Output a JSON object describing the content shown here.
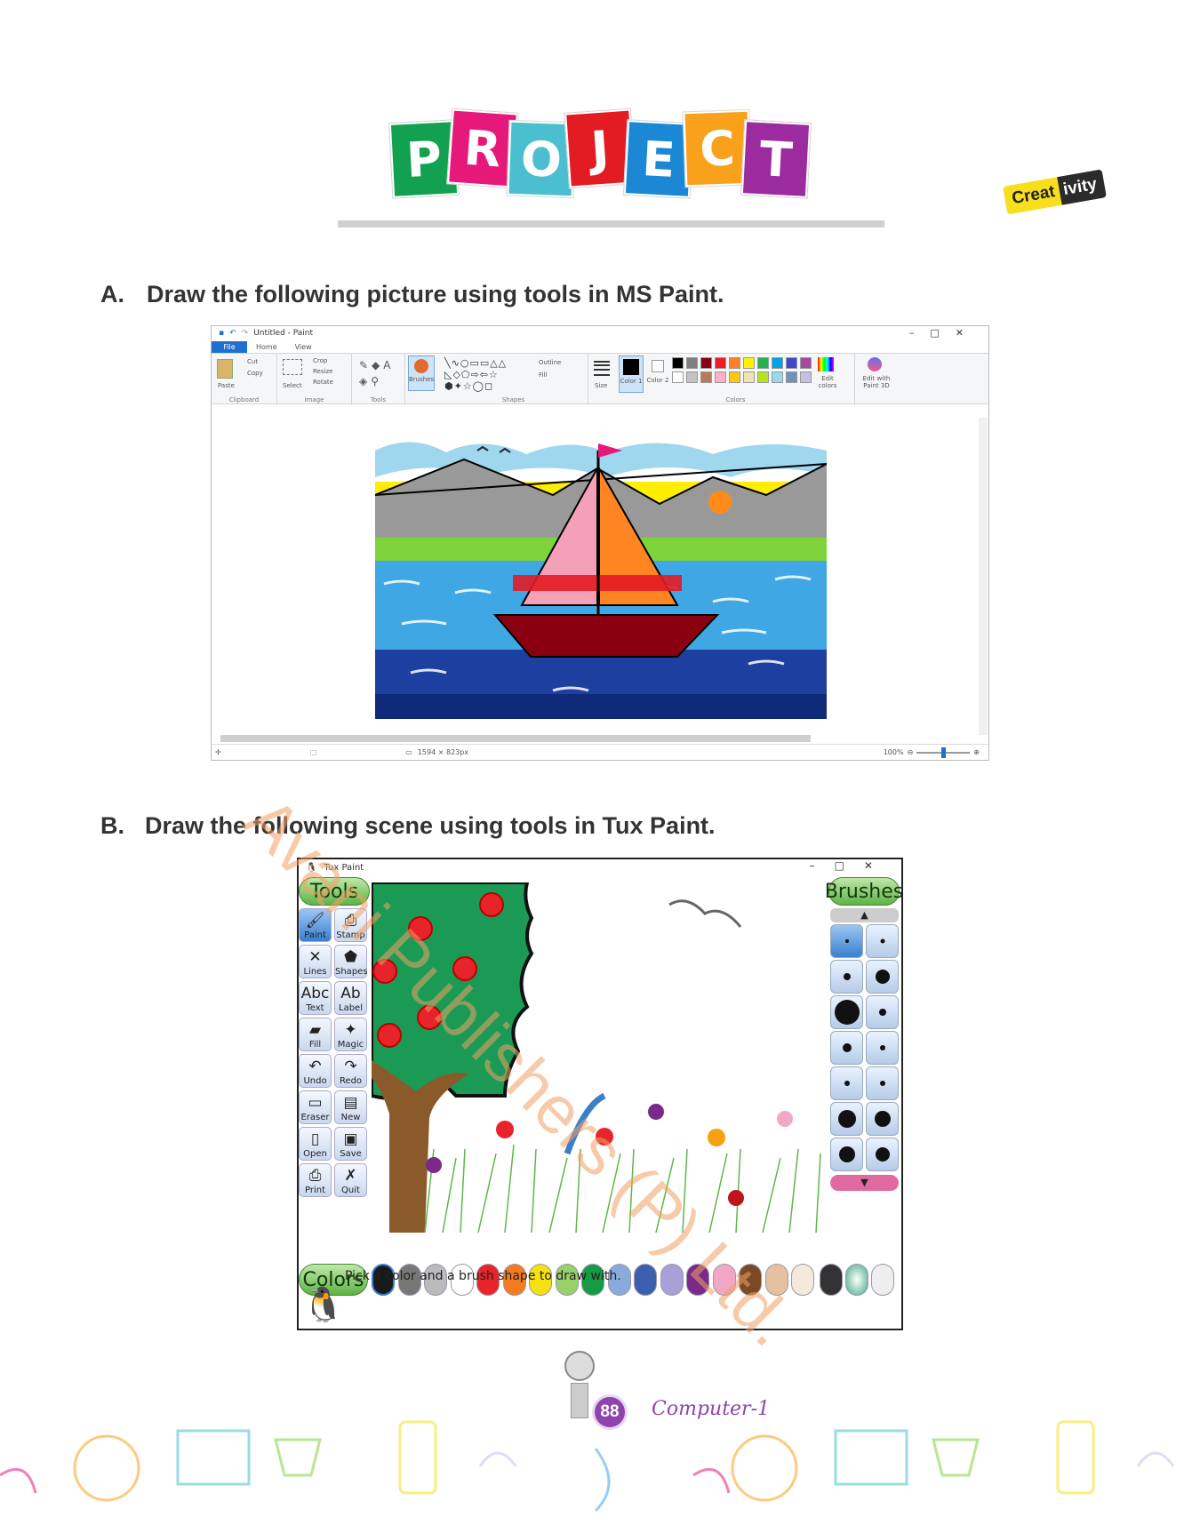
{
  "header": {
    "title_letters": [
      {
        "ch": "P",
        "color": "#12a150"
      },
      {
        "ch": "R",
        "color": "#e6197b"
      },
      {
        "ch": "O",
        "color": "#4bbfcf"
      },
      {
        "ch": "J",
        "color": "#e31b23"
      },
      {
        "ch": "E",
        "color": "#1a88d4"
      },
      {
        "ch": "C",
        "color": "#f9a11b"
      },
      {
        "ch": "T",
        "color": "#9b2b9e"
      }
    ],
    "badge_part1": "Creat",
    "badge_part2": "ivity"
  },
  "section_a": {
    "label": "A.",
    "text": "Draw the following picture using tools in MS Paint."
  },
  "paint": {
    "title": "Untitled - Paint",
    "tabs": [
      "File",
      "Home",
      "View"
    ],
    "clipboard": {
      "paste": "Paste",
      "cut": "Cut",
      "copy": "Copy",
      "group": "Clipboard"
    },
    "image": {
      "select": "Select",
      "crop": "Crop",
      "resize": "Resize",
      "rotate": "Rotate",
      "group": "Image"
    },
    "tools_group": "Tools",
    "brushes": "Brushes",
    "shapes": {
      "outline": "Outline",
      "fill": "Fill",
      "group": "Shapes"
    },
    "size": "Size",
    "color1": "Color 1",
    "color2": "Color 2",
    "colors_group": "Colors",
    "edit_colors": "Edit colors",
    "edit_3d": "Edit with Paint 3D",
    "dimensions": "1594 × 823px",
    "zoom": "100%",
    "palette": [
      "#000000",
      "#7f7f7f",
      "#880015",
      "#ed1c24",
      "#ff7f27",
      "#fff200",
      "#22b14c",
      "#00a2e8",
      "#3f48cc",
      "#a349a4",
      "#ffffff",
      "#c3c3c3",
      "#b97a57",
      "#ffaec9",
      "#ffc90e",
      "#efe4b0",
      "#b5e61d",
      "#99d9ea",
      "#7092be",
      "#c8bfe7"
    ]
  },
  "section_b": {
    "label": "B.",
    "text": "Draw the following scene using tools in Tux Paint."
  },
  "tux": {
    "title": "Tux Paint",
    "tools_header": "Tools",
    "brushes_header": "Brushes",
    "colors_header": "Colors",
    "tools": [
      {
        "label": "Paint",
        "icon": "🖌"
      },
      {
        "label": "Stamp",
        "icon": "⎙"
      },
      {
        "label": "Lines",
        "icon": "✕"
      },
      {
        "label": "Shapes",
        "icon": "⬟"
      },
      {
        "label": "Text",
        "icon": "Abc"
      },
      {
        "label": "Label",
        "icon": "Ab"
      },
      {
        "label": "Fill",
        "icon": "▰"
      },
      {
        "label": "Magic",
        "icon": "✦"
      },
      {
        "label": "Undo",
        "icon": "↶"
      },
      {
        "label": "Redo",
        "icon": "↷"
      },
      {
        "label": "Eraser",
        "icon": "▭"
      },
      {
        "label": "New",
        "icon": "▤"
      },
      {
        "label": "Open",
        "icon": "▯"
      },
      {
        "label": "Save",
        "icon": "▣"
      },
      {
        "label": "Print",
        "icon": "⎙"
      },
      {
        "label": "Quit",
        "icon": "✗"
      }
    ],
    "colors": [
      "#1a1a1a",
      "#777777",
      "#bbbbbb",
      "#ffffff",
      "#e8242b",
      "#f47c20",
      "#f6e012",
      "#98d06a",
      "#169a43",
      "#88aadd",
      "#3c5fb0",
      "#a8a0d8",
      "#7a2a8a",
      "#f2a7c6",
      "#7b4a24",
      "#e6c1a0",
      "#f5e9dc"
    ],
    "status": "Pick a color and a brush shape to draw with."
  },
  "footer": {
    "page_number": "88",
    "book": "Computer-1"
  },
  "watermark": "Avani Publishers (P) Ltd."
}
